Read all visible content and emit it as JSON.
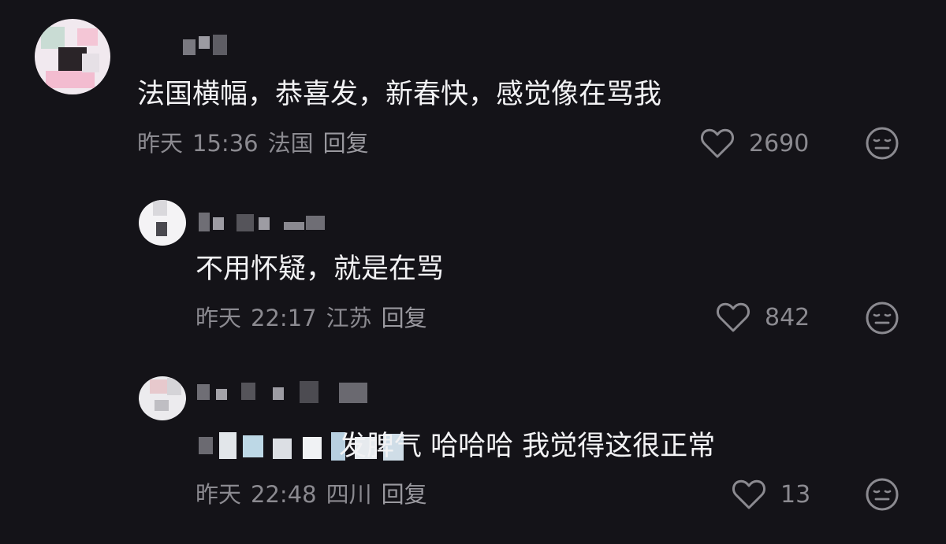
{
  "comments": [
    {
      "text": "法国横幅，恭喜发，新春快，感觉像在骂我",
      "date": "昨天",
      "time": "15:36",
      "location": "法国",
      "reply_label": "回复",
      "likes": "2690"
    },
    {
      "text": "不用怀疑，就是在骂",
      "date": "昨天",
      "time": "22:17",
      "location": "江苏",
      "reply_label": "回复",
      "likes": "842"
    },
    {
      "text_visible": "发脾气  哈哈哈  我觉得这很正常",
      "date": "昨天",
      "time": "22:48",
      "location": "四川",
      "reply_label": "回复",
      "likes": "13"
    }
  ],
  "icons": {
    "like": "heart-outline-icon",
    "dislike": "meh-face-icon"
  },
  "colors": {
    "background": "#141318",
    "text": "#f2f2f4",
    "meta": "#8b8a90"
  }
}
